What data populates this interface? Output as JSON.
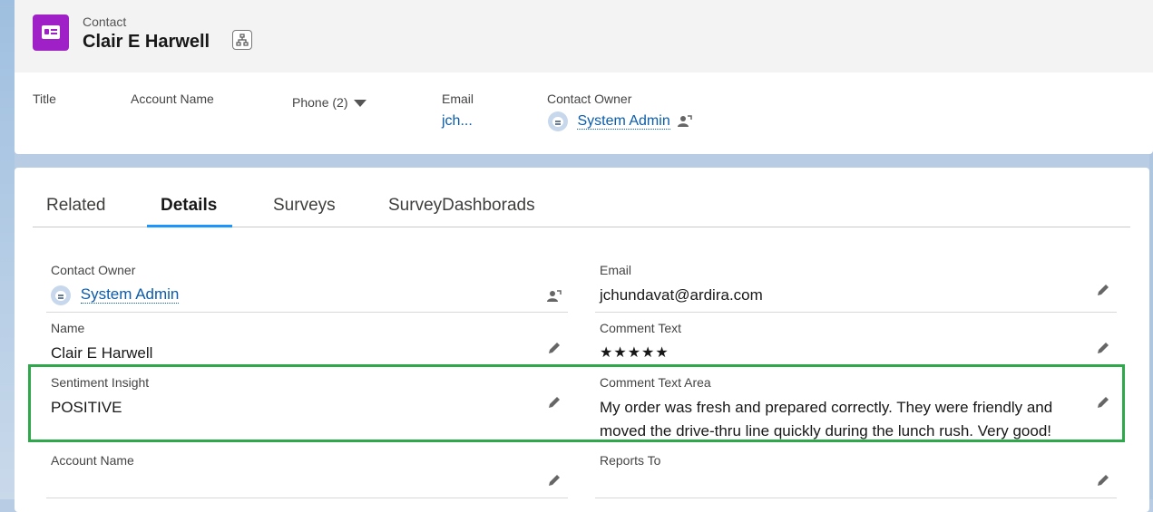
{
  "header": {
    "object_type": "Contact",
    "record_name": "Clair E Harwell",
    "fields": {
      "title_label": "Title",
      "account_label": "Account Name",
      "phone_label": "Phone (2)",
      "email_label": "Email",
      "email_value": "jch...",
      "owner_label": "Contact Owner",
      "owner_value": "System Admin"
    }
  },
  "tabs": [
    "Related",
    "Details",
    "Surveys",
    "SurveyDashborads"
  ],
  "active_tab": "Details",
  "details": {
    "contact_owner": {
      "label": "Contact Owner",
      "value": "System Admin"
    },
    "email": {
      "label": "Email",
      "value": "jchundavat@ardira.com"
    },
    "name": {
      "label": "Name",
      "value": "Clair E Harwell"
    },
    "comment_text": {
      "label": "Comment Text",
      "value": "★★★★★"
    },
    "sentiment": {
      "label": "Sentiment Insight",
      "value": "POSITIVE"
    },
    "comment_area": {
      "label": "Comment Text Area",
      "line1": "My order was fresh and prepared correctly. They were friendly and",
      "line2": "moved the drive-thru line quickly during the lunch rush. Very good!"
    },
    "account_name": {
      "label": "Account Name",
      "value": ""
    },
    "reports_to": {
      "label": "Reports To",
      "value": ""
    }
  },
  "colors": {
    "object_icon": "#a020c8",
    "link": "#0b5cab",
    "tab_accent": "#1b96ff",
    "highlight_border": "#2ea84a"
  },
  "icons": [
    "contact-card-icon",
    "hierarchy-icon",
    "dropdown-caret-icon",
    "avatar-icon",
    "change-owner-icon",
    "pencil-edit-icon"
  ]
}
